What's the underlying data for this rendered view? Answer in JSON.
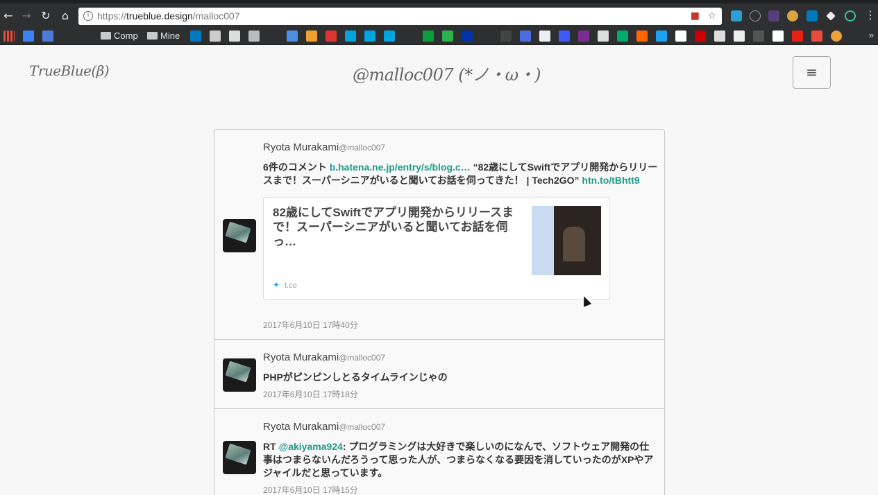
{
  "browser": {
    "url_scheme": "https://",
    "url_host": "trueblue.design",
    "url_path": "/malloc007",
    "back_glyph": "←",
    "forward_glyph": "→",
    "reload_glyph": "↻",
    "home_glyph": "⌂",
    "star_glyph": "☆",
    "menu_glyph": "⋮"
  },
  "bookmarks": {
    "folders": [
      {
        "label": "Comp"
      },
      {
        "label": "Mine"
      }
    ],
    "more_glyph": "»"
  },
  "header": {
    "brand": "TrueBlue(β)",
    "title": "@malloc007 (*ノ・ω・)",
    "menu_glyph": "≡"
  },
  "tweets": [
    {
      "author": "Ryota Murakami",
      "handle": "@malloc007",
      "text_prefix": "6件のコメント ",
      "link1": "b.hatena.ne.jp/entry/s/blog.c…",
      "text_mid": " “82歳にしてSwiftでアプリ開発からリリースまで！スーパーシニアがいると聞いてお話を伺ってきた！ | Tech2GO” ",
      "link2": "htn.to/tBhtt9",
      "card_title": "82歳にしてSwiftでアプリ開発からリリースまで！スーパーシニアがいると聞いてお話を伺っ…",
      "card_source": "t.co",
      "time": "2017年6月10日 17時40分"
    },
    {
      "author": "Ryota Murakami",
      "handle": "@malloc007",
      "text": "PHPがピンピンしとるタイムラインじゃの",
      "time": "2017年6月10日 17時18分"
    },
    {
      "author": "Ryota Murakami",
      "handle": "@malloc007",
      "text_prefix": "RT ",
      "mention": "@akiyama924",
      "text_rest": ": プログラミングは大好きで楽しいのになんで、ソフトウェア開発の仕事はつまらないんだろうって思った人が、つまらなくなる要因を消していったのがXPやアジャイルだと思っています。",
      "time": "2017年6月10日 17時15分"
    }
  ],
  "colors": {
    "link": "#1d9a8a",
    "page_bg": "#f7f7f7",
    "chrome_bg": "#2e2f31"
  }
}
